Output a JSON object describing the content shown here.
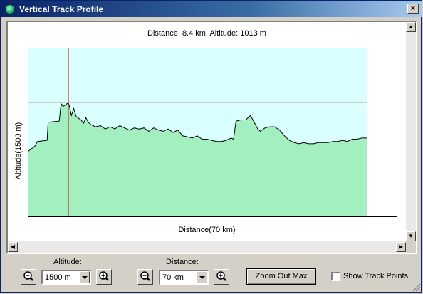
{
  "window": {
    "title": "Vertical Track Profile",
    "close_label": "×"
  },
  "profile": {
    "title": "Distance: 8.4 km, Altitude: 1013 m",
    "xlabel": "Distance(70 km)",
    "ylabel": "Altitude(1500 m)"
  },
  "controls": {
    "altitude_label": "Altitude:",
    "altitude_value": "1500 m",
    "distance_label": "Distance:",
    "distance_value": "70 km",
    "zoom_out_max_label": "Zoom Out Max",
    "show_track_points_label": "Show Track Points",
    "show_track_points_checked": false
  },
  "colors": {
    "fill": "#a3efbf",
    "sky": "#d9ffff",
    "cursor": "#c0392b"
  },
  "chart_data": {
    "type": "area",
    "xlabel": "Distance(70 km)",
    "ylabel": "Altitude(1500 m)",
    "xlim": [
      0,
      70
    ],
    "ylim": [
      0,
      1500
    ],
    "cursor": {
      "x": 8.4,
      "y": 1013
    },
    "x": [
      0,
      1.5,
      2,
      4,
      4.2,
      6.5,
      6.8,
      7,
      7.3,
      8.4,
      8.6,
      9,
      9.5,
      10,
      11,
      11.5,
      12,
      12.5,
      13,
      14,
      15,
      16,
      17,
      18,
      19,
      20,
      21,
      22,
      23,
      24,
      25,
      26,
      27,
      28,
      29,
      30,
      31,
      32,
      33,
      34,
      35,
      36,
      37,
      38,
      39,
      40,
      41,
      42,
      42.5,
      43,
      44,
      45,
      46,
      47,
      47.5,
      48,
      49,
      50,
      51,
      52,
      53,
      54,
      55,
      56,
      57,
      58,
      59,
      60,
      61,
      62,
      63,
      64,
      65,
      66,
      67,
      68,
      69,
      70
    ],
    "y": [
      580,
      630,
      670,
      680,
      840,
      850,
      970,
      1000,
      980,
      1013,
      980,
      900,
      960,
      890,
      860,
      830,
      880,
      840,
      820,
      800,
      810,
      780,
      800,
      780,
      810,
      790,
      770,
      790,
      780,
      790,
      760,
      790,
      770,
      760,
      780,
      750,
      770,
      720,
      710,
      700,
      720,
      690,
      690,
      680,
      670,
      670,
      680,
      700,
      690,
      850,
      860,
      860,
      900,
      820,
      780,
      760,
      790,
      800,
      800,
      770,
      720,
      680,
      660,
      650,
      660,
      650,
      650,
      660,
      660,
      660,
      670,
      670,
      680,
      670,
      690,
      690,
      700,
      700
    ]
  }
}
